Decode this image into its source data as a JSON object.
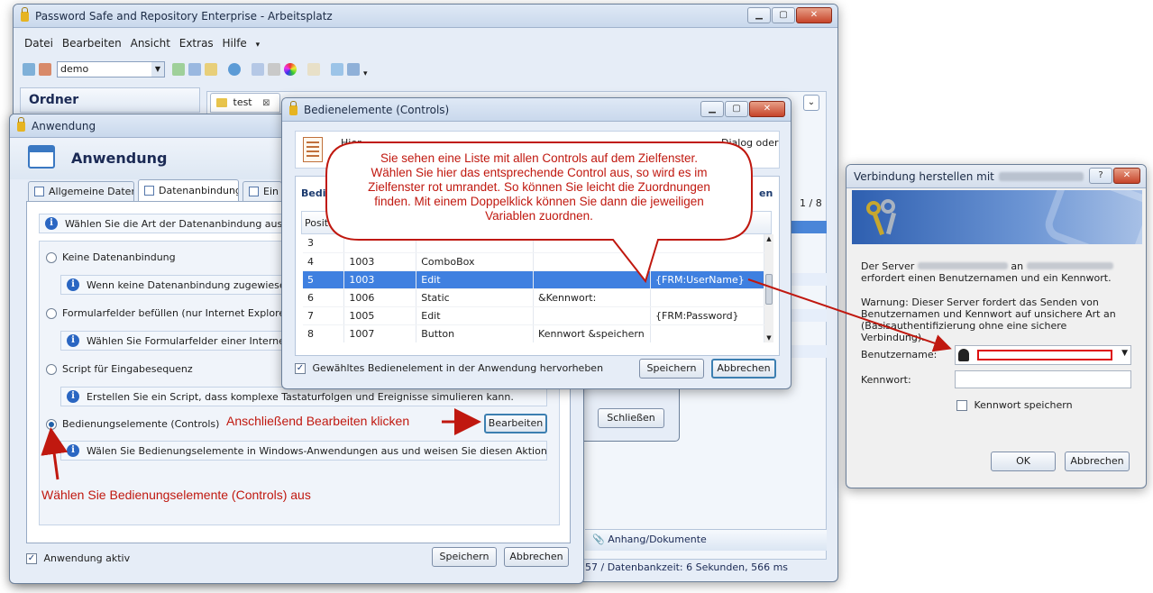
{
  "main": {
    "title": "Password Safe and Repository Enterprise - Arbeitsplatz",
    "menu": [
      "Datei",
      "Bearbeiten",
      "Ansicht",
      "Extras",
      "Hilfe"
    ],
    "db_select": "demo",
    "sidebar_title": "Ordner",
    "doc_tab": "test",
    "page_indicator": "1 / 8",
    "attach_label": "Anhang/Dokumente",
    "status": "57 / Datenbankzeit: 6 Sekunden, 566 ms",
    "close_btn": "Schließen"
  },
  "app": {
    "title": "Anwendung",
    "header": "Anwendung",
    "tabs": [
      "Allgemeine Daten",
      "Datenanbindung",
      "Ein"
    ],
    "intro": "Wählen Sie die Art der Datenanbindung aus und be",
    "options": [
      {
        "label": "Keine Datenanbindung",
        "info": "Wenn keine Datenanbindung zugewiesen wur"
      },
      {
        "label": "Formularfelder befüllen (nur Internet Explorer)",
        "info": "Wählen Sie Formularfelder einer Internetseite"
      },
      {
        "label": "Script für Eingabesequenz",
        "info": "Erstellen Sie ein Script, dass komplexe Tastaturfolgen und Ereignisse simulieren kann."
      },
      {
        "label": "Bedienungselemente (Controls)",
        "info": "Wälen Sie Bedienungselemente in Windows-Anwendungen aus und weisen Sie diesen Aktionen zu."
      }
    ],
    "edit_btn": "Bearbeiten",
    "active_label": "Anwendung aktiv",
    "save_btn": "Speichern",
    "cancel_btn": "Abbrechen"
  },
  "controls": {
    "title": "Bedienelemente (Controls)",
    "desc_start": "Hier",
    "desc_end": "Dialog oder",
    "tab_start": "Bedie",
    "tab_end": "en",
    "col_pos": "Positi",
    "rows": [
      [
        "3",
        "",
        "",
        "",
        ""
      ],
      [
        "4",
        "1003",
        "ComboBox",
        "",
        ""
      ],
      [
        "5",
        "1003",
        "Edit",
        "",
        "{FRM:UserName}"
      ],
      [
        "6",
        "1006",
        "Static",
        "&Kennwort:",
        ""
      ],
      [
        "7",
        "1005",
        "Edit",
        "",
        "{FRM:Password}"
      ],
      [
        "8",
        "1007",
        "Button",
        "Kennwort &speichern",
        ""
      ]
    ],
    "highlight_label": "Gewähltes Bedienelement in der Anwendung hervorheben",
    "save_btn": "Speichern",
    "cancel_btn": "Abbrechen"
  },
  "conn": {
    "title": "Verbindung herstellen mit",
    "help": "?",
    "line1a": "Der Server",
    "line1b": "an",
    "line1c": "erfordert einen Benutzernamen und ein Kennwort.",
    "warning": "Warnung: Dieser Server fordert das Senden von Benutzernamen und Kennwort auf unsichere Art an (Basisauthentifizierung ohne eine sichere Verbindung).",
    "user_label": "Benutzername:",
    "pass_label": "Kennwort:",
    "remember": "Kennwort speichern",
    "ok_btn": "OK",
    "cancel_btn": "Abbrechen"
  },
  "annotations": {
    "callout": "Sie sehen eine Liste mit allen Controls auf dem Zielfenster. Wählen Sie hier das entsprechende Control aus, so wird es im Zielfenster rot umrandet. So können Sie leicht die Zuordnungen finden. Mit einem Doppelklick können Sie dann die jeweiligen Variablen zuordnen.",
    "then_edit": "Anschließend Bearbeiten klicken",
    "choose": "Wählen Sie Bedienungselemente (Controls) aus"
  }
}
